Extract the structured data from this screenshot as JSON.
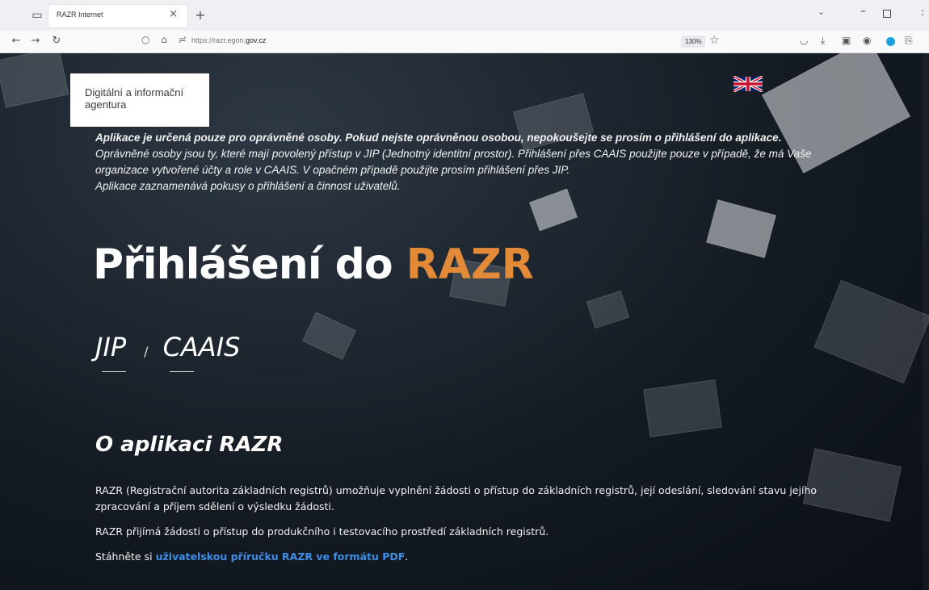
{
  "browser": {
    "tab_title": "RAZR Internet",
    "url_prefix": "https://razr.egon.",
    "url_domain": "gov.cz",
    "zoom": "130%"
  },
  "logo": {
    "line1": "Digitální a informační",
    "line2": "agentura"
  },
  "notice": {
    "warning": "Aplikace je určená pouze pro oprávněné osoby. Pokud nejste oprávněnou osobou, nepokoušejte se prosím o přihlášení do aplikace.",
    "info": "Oprávněné osoby jsou ty, které mají povolený přístup v JIP (Jednotný identitní prostor). Přihlášení přes CAAIS použijte pouze v případě, že má Vaše organizace vytvořené účty a role v CAAIS. V opačném případě použijte prosím přihlášení přes JIP.",
    "logging": "Aplikace zaznamenává pokusy o přihlášení a činnost uživatelů."
  },
  "title": {
    "prefix": "Přihlášení do ",
    "accent": "RAZR"
  },
  "login": {
    "jip": "JIP",
    "separator": "/",
    "caais": "CAAIS"
  },
  "about": {
    "heading": "O aplikaci RAZR",
    "p1": "RAZR (Registrační autorita základních registrů) umožňuje vyplnění žádosti o přístup do základních registrů, její odeslání, sledování stavu jejího zpracování a příjem sdělení o výsledku žádosti.",
    "p2": "RAZR přijímá žádosti o přístup do produkčního i testovacího prostředí základních registrů.",
    "p3_prefix": "Stáhněte si ",
    "p3_link": "uživatelskou příručku RAZR ve formátu PDF",
    "p3_suffix": "."
  },
  "colors": {
    "accent": "#e38a38",
    "link": "#3d8ee6",
    "background": "#141b23"
  },
  "icons": {
    "tab_list": "tab-list-icon",
    "close": "close-icon",
    "new_tab": "plus-icon",
    "back": "arrow-left-icon",
    "forward": "arrow-right-icon",
    "reload": "reload-icon",
    "bookmark": "star-icon",
    "language": "uk-flag-icon"
  }
}
